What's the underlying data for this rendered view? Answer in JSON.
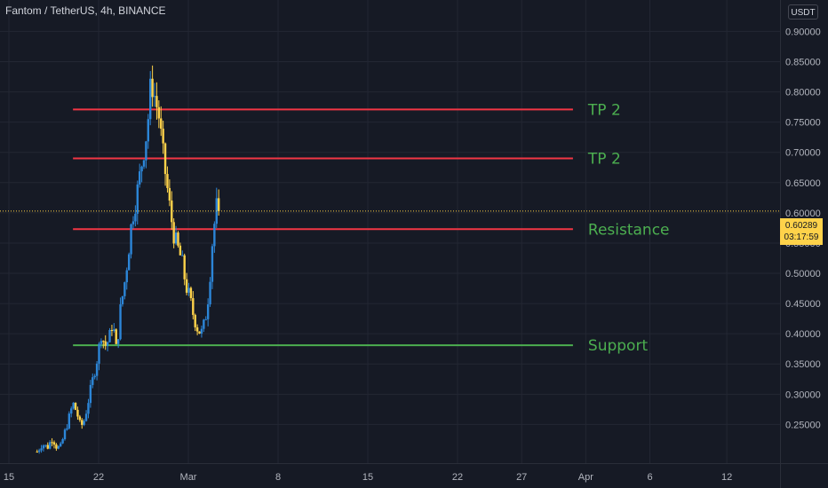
{
  "title": "Fantom / TetherUS, 4h, BINANCE",
  "currency": "USDT",
  "price_tag": {
    "price": "0.60289",
    "countdown": "03:17:59"
  },
  "colors": {
    "background": "#161a25",
    "grid": "#232733",
    "axis_text": "#b2b5be",
    "up": "#2c86d8",
    "down": "#fed24a",
    "red_line": "#f23645",
    "green_line": "#4caf50",
    "label_green": "#4caf50"
  },
  "chart_data": {
    "type": "candlestick",
    "title": "Fantom / TetherUS, 4h, BINANCE",
    "y_axis": {
      "ylim": [
        0.186,
        0.952
      ],
      "ticks": [
        "0.90000",
        "0.85000",
        "0.80000",
        "0.75000",
        "0.70000",
        "0.65000",
        "0.60000",
        "0.55000",
        "0.50000",
        "0.45000",
        "0.40000",
        "0.35000",
        "0.30000",
        "0.25000"
      ],
      "tick_values": [
        0.9,
        0.85,
        0.8,
        0.75,
        0.7,
        0.65,
        0.6,
        0.55,
        0.5,
        0.45,
        0.4,
        0.35,
        0.3,
        0.25
      ]
    },
    "x_axis": {
      "ticks": [
        "15",
        "22",
        "Mar",
        "8",
        "15",
        "22",
        "27",
        "Apr",
        "6",
        "12"
      ],
      "tick_days": [
        15,
        22,
        29,
        36,
        43,
        50,
        55,
        60,
        65,
        71
      ]
    },
    "last_price": 0.60289,
    "levels": [
      {
        "label": "TP 2",
        "value": 0.771,
        "color": "#f23645",
        "from_day": 20,
        "to_day": 59
      },
      {
        "label": "TP 2",
        "value": 0.69,
        "color": "#f23645",
        "from_day": 20,
        "to_day": 59
      },
      {
        "label": "Resistance",
        "value": 0.573,
        "color": "#f23645",
        "from_day": 20,
        "to_day": 59
      },
      {
        "label": "Support",
        "value": 0.381,
        "color": "#4caf50",
        "from_day": 20,
        "to_day": 59
      }
    ],
    "path": [
      [
        17.2,
        0.205
      ],
      [
        17.6,
        0.218
      ],
      [
        18.0,
        0.212
      ],
      [
        18.4,
        0.228
      ],
      [
        18.7,
        0.214
      ],
      [
        19.0,
        0.21
      ],
      [
        19.4,
        0.24
      ],
      [
        19.7,
        0.262
      ],
      [
        20.0,
        0.285
      ],
      [
        20.3,
        0.27
      ],
      [
        20.6,
        0.245
      ],
      [
        20.9,
        0.258
      ],
      [
        21.3,
        0.3
      ],
      [
        21.6,
        0.33
      ],
      [
        21.9,
        0.36
      ],
      [
        22.2,
        0.4
      ],
      [
        22.5,
        0.38
      ],
      [
        22.8,
        0.39
      ],
      [
        23.1,
        0.42
      ],
      [
        23.4,
        0.37
      ],
      [
        23.7,
        0.44
      ],
      [
        24.0,
        0.48
      ],
      [
        24.3,
        0.53
      ],
      [
        24.6,
        0.59
      ],
      [
        24.9,
        0.62
      ],
      [
        25.2,
        0.66
      ],
      [
        25.5,
        0.7
      ],
      [
        25.8,
        0.74
      ],
      [
        26.1,
        0.82
      ],
      [
        26.4,
        0.79
      ],
      [
        26.7,
        0.76
      ],
      [
        27.0,
        0.7
      ],
      [
        27.3,
        0.65
      ],
      [
        27.6,
        0.6
      ],
      [
        27.9,
        0.56
      ],
      [
        28.2,
        0.54
      ],
      [
        28.5,
        0.52
      ],
      [
        28.8,
        0.48
      ],
      [
        29.1,
        0.46
      ],
      [
        29.4,
        0.43
      ],
      [
        29.7,
        0.41
      ],
      [
        30.0,
        0.4
      ],
      [
        30.3,
        0.42
      ],
      [
        30.6,
        0.47
      ],
      [
        30.9,
        0.56
      ],
      [
        31.2,
        0.61
      ],
      [
        31.4,
        0.603
      ]
    ]
  }
}
